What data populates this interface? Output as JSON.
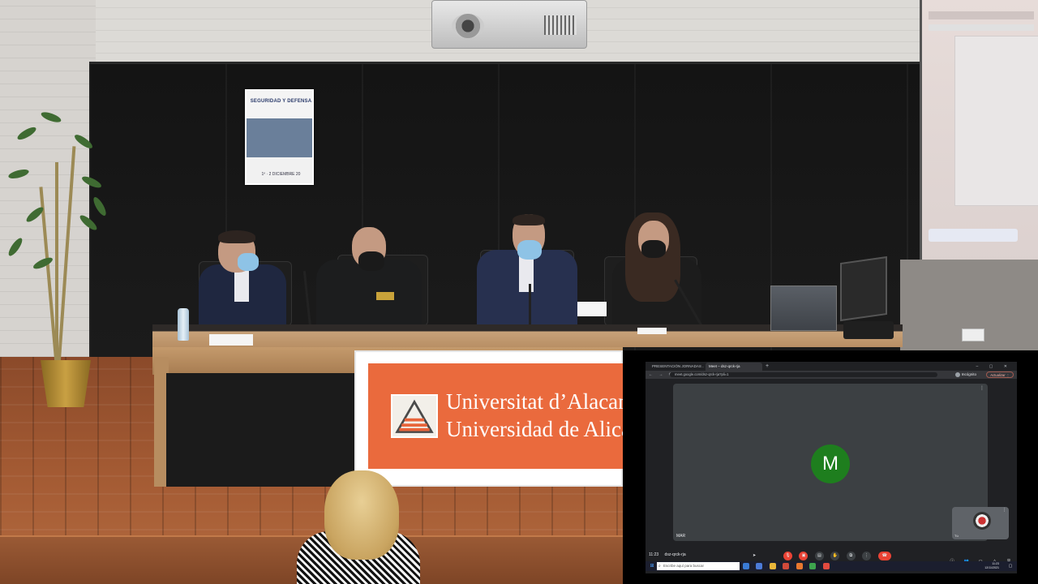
{
  "banner": {
    "line1": "Universitat d’Alacant",
    "line2": "Universidad de Alicante"
  },
  "poster": {
    "title": "SEGURIDAD Y DEFENSA",
    "dates": "1º · 2 DICIEMBRE 20"
  },
  "meet": {
    "tabs": [
      {
        "label": "PRESENTACIÓN JORNADAS ...",
        "active": false
      },
      {
        "label": "Meet – dsz-qrck-rja",
        "active": true
      }
    ],
    "new_tab_label": "+",
    "window_controls": "– ▢ ✕",
    "nav": "← → ⟳",
    "url": "meet.google.com/dsz-qrck-rja?pli=1",
    "profile_label": "Incógnito",
    "update_label": "Actualizar ⋮",
    "participant_initial": "M",
    "participant_name": "MAR",
    "self_label": "Tú",
    "time": "11:23",
    "meeting_code": "dsz-qrck-rja",
    "search_placeholder": "Escribe aquí para buscar",
    "tray_time": "11:23",
    "tray_date": "12/11/2021",
    "colors": {
      "avatar": "#1e7e1e",
      "end_call": "#ea4335",
      "tile": "#3c4043",
      "stage": "#202124"
    }
  }
}
